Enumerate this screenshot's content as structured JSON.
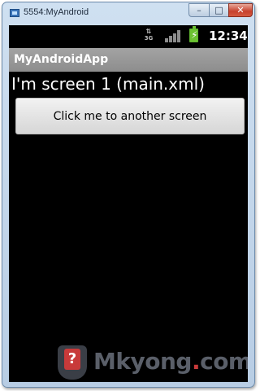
{
  "window": {
    "title": "5554:MyAndroid",
    "min_glyph": "–",
    "max_glyph": "□",
    "close_glyph": "✕"
  },
  "status_bar": {
    "network": "3G",
    "time": "12:34",
    "battery_glyph": "⚡"
  },
  "app": {
    "title": "MyAndroidApp",
    "screen_text": "I'm screen 1 (main.xml)",
    "button_label": "Click me to another screen"
  },
  "watermark": {
    "logo_glyph": "?",
    "name_before_dot": "Mkyong",
    "dot": ".",
    "name_after_dot": "com"
  },
  "colors": {
    "screen_bg": "#000000",
    "action_bar": "#9a9a9a",
    "battery": "#6cc331",
    "watermark_red": "#c83a3a"
  }
}
